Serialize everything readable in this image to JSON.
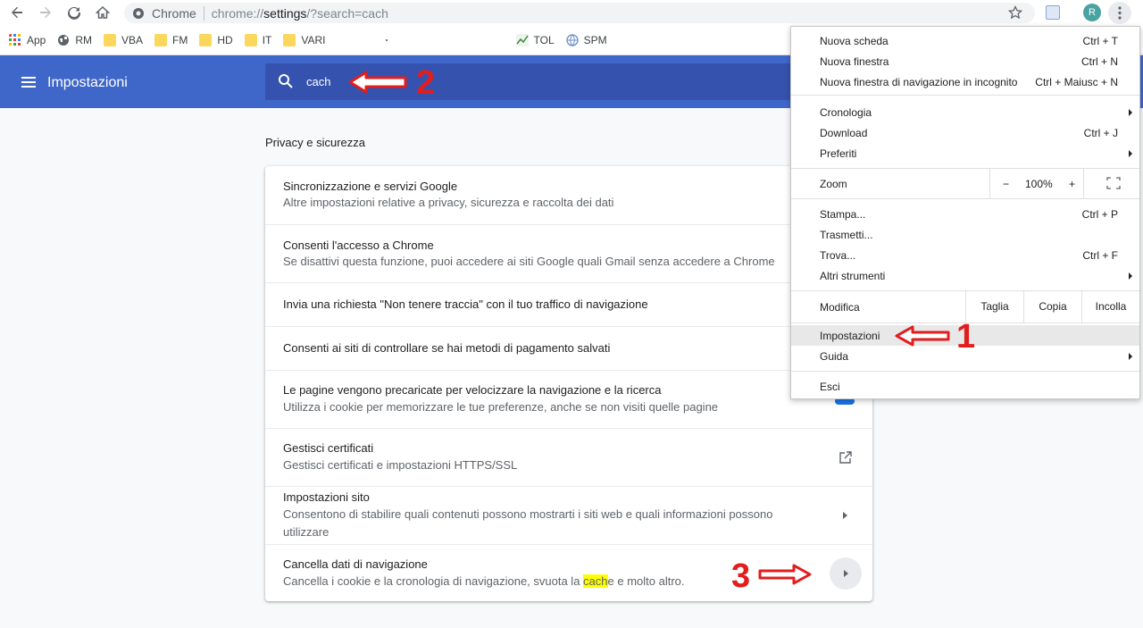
{
  "browser": {
    "site_label": "Chrome",
    "url_prefix": "chrome://",
    "url_highlight": "settings",
    "url_suffix": "/?search=cach",
    "profile_initial": "R"
  },
  "bookmarks": [
    {
      "label": "App",
      "icon": "apps-grid-icon"
    },
    {
      "label": "RM",
      "icon": "globe-icon"
    },
    {
      "label": "VBA",
      "icon": "folder-icon"
    },
    {
      "label": "FM",
      "icon": "folder-icon"
    },
    {
      "label": "HD",
      "icon": "folder-icon"
    },
    {
      "label": "IT",
      "icon": "folder-icon"
    },
    {
      "label": "VARI",
      "icon": "folder-icon"
    },
    {
      "label": "TOL",
      "icon": "chart-icon"
    },
    {
      "label": "SPM",
      "icon": "globe-icon"
    }
  ],
  "settings": {
    "title": "Impostazioni",
    "search_query": "cach",
    "section_title": "Privacy e sicurezza",
    "rows": [
      {
        "title": "Sincronizzazione e servizi Google",
        "subtitle": "Altre impostazioni relative a privacy, sicurezza e raccolta dei dati"
      },
      {
        "title": "Consenti l'accesso a Chrome",
        "subtitle": "Se disattivi questa funzione, puoi accedere ai siti Google quali Gmail senza accedere a Chrome"
      },
      {
        "title": "Invia una richiesta \"Non tenere traccia\" con il tuo traffico di navigazione"
      },
      {
        "title": "Consenti ai siti di controllare se hai metodi di pagamento salvati"
      },
      {
        "title": "Le pagine vengono precaricate per velocizzare la navigazione e la ricerca",
        "subtitle": "Utilizza i cookie per memorizzare le tue preferenze, anche se non visiti quelle pagine"
      },
      {
        "title": "Gestisci certificati",
        "subtitle": "Gestisci certificati e impostazioni HTTPS/SSL"
      },
      {
        "title": "Impostazioni sito",
        "subtitle": "Consentono di stabilire quali contenuti possono mostrarti i siti web e quali informazioni possono utilizzare"
      },
      {
        "title": "Cancella dati di navigazione",
        "subtitle_before": "Cancella i cookie e la cronologia di navigazione, svuota la ",
        "subtitle_highlight": "cach",
        "subtitle_after": "e e molto altro."
      }
    ]
  },
  "menu": {
    "new_tab": {
      "label": "Nuova scheda",
      "shortcut": "Ctrl + T"
    },
    "new_window": {
      "label": "Nuova finestra",
      "shortcut": "Ctrl + N"
    },
    "new_incognito": {
      "label": "Nuova finestra di navigazione in incognito",
      "shortcut": "Ctrl + Maiusc + N"
    },
    "history": {
      "label": "Cronologia"
    },
    "downloads": {
      "label": "Download",
      "shortcut": "Ctrl + J"
    },
    "bookmarks": {
      "label": "Preferiti"
    },
    "zoom": {
      "label": "Zoom",
      "minus": "−",
      "value": "100%",
      "plus": "+"
    },
    "print": {
      "label": "Stampa...",
      "shortcut": "Ctrl + P"
    },
    "cast": {
      "label": "Trasmetti..."
    },
    "find": {
      "label": "Trova...",
      "shortcut": "Ctrl + F"
    },
    "more_tools": {
      "label": "Altri strumenti"
    },
    "edit": {
      "label": "Modifica",
      "cut": "Taglia",
      "copy": "Copia",
      "paste": "Incolla"
    },
    "settings": {
      "label": "Impostazioni"
    },
    "help": {
      "label": "Guida"
    },
    "exit": {
      "label": "Esci"
    }
  },
  "annotations": {
    "n1": "1",
    "n2": "2",
    "n3": "3"
  },
  "colors": {
    "header": "#3f67c9",
    "search": "#3553ae",
    "annotation": "#e21d1d",
    "highlight": "#ffff00"
  }
}
